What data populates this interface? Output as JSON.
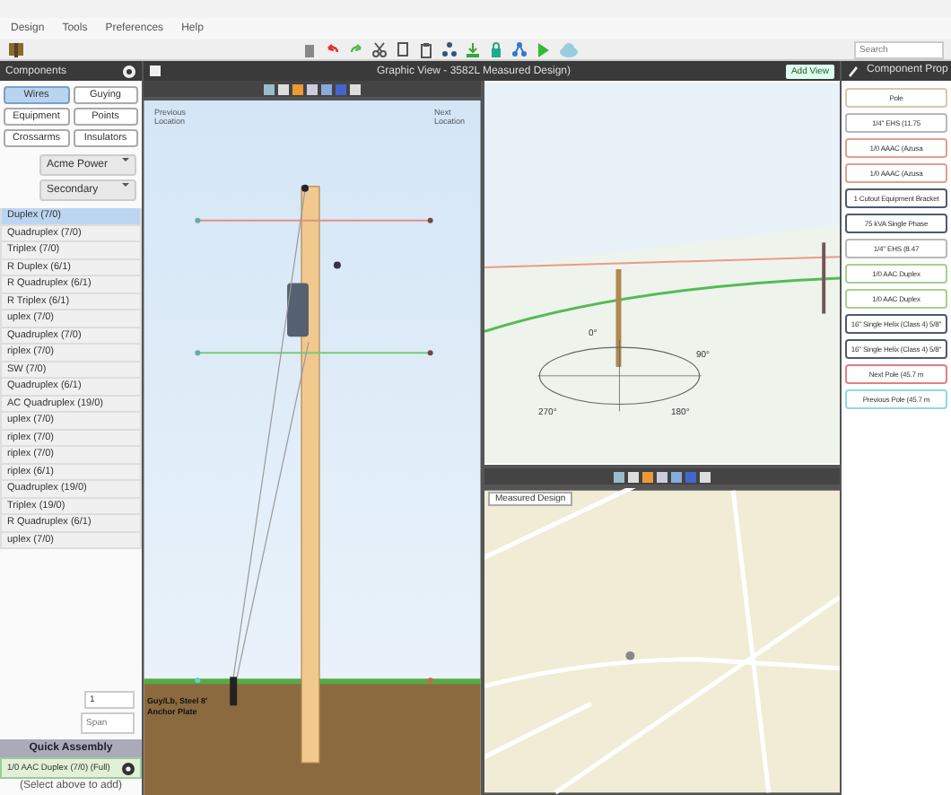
{
  "menu": [
    {
      "label": "Design"
    },
    {
      "label": "Tools"
    },
    {
      "label": "Preferences"
    },
    {
      "label": "Help"
    }
  ],
  "toolbar": {
    "search_placeholder": "Search"
  },
  "components_panel": {
    "title": "Components",
    "categories": [
      {
        "label": "Wires",
        "selected": true
      },
      {
        "label": "Guying",
        "selected": false
      },
      {
        "label": "Equipment",
        "selected": false
      },
      {
        "label": "Points",
        "selected": false
      },
      {
        "label": "Crossarms",
        "selected": false
      },
      {
        "label": "Insulators",
        "selected": false
      }
    ],
    "dropdowns": [
      "Acme Power",
      "Secondary"
    ],
    "items": [
      {
        "label": "Duplex (7/0)",
        "selected": true
      },
      {
        "label": "Quadruplex (7/0)",
        "selected": false
      },
      {
        "label": "Triplex (7/0)",
        "selected": false
      },
      {
        "label": "R Duplex (6/1)",
        "selected": false
      },
      {
        "label": "R Quadruplex (6/1)",
        "selected": false
      },
      {
        "label": "R Triplex (6/1)",
        "selected": false
      },
      {
        "label": "uplex (7/0)",
        "selected": false
      },
      {
        "label": "Quadruplex (7/0)",
        "selected": false
      },
      {
        "label": "riplex (7/0)",
        "selected": false
      },
      {
        "label": "SW (7/0)",
        "selected": false
      },
      {
        "label": "Quadruplex (6/1)",
        "selected": false
      },
      {
        "label": "AC Quadruplex (19/0)",
        "selected": false
      },
      {
        "label": "uplex (7/0)",
        "selected": false
      },
      {
        "label": "riplex (7/0)",
        "selected": false
      },
      {
        "label": "riplex (7/0)",
        "selected": false
      },
      {
        "label": "riplex (6/1)",
        "selected": false
      },
      {
        "label": "Quadruplex (19/0)",
        "selected": false
      },
      {
        "label": "Triplex (19/0)",
        "selected": false
      },
      {
        "label": "R Quadruplex (6/1)",
        "selected": false
      },
      {
        "label": "uplex (7/0)",
        "selected": false
      }
    ],
    "quantity": "1",
    "span_placeholder": "Span",
    "quick_assembly": {
      "title": "Quick Assembly",
      "item": "1/0 AAC Duplex (7/0) (Full)",
      "hint": "(Select above to add)"
    }
  },
  "graphic_view": {
    "title": "Graphic View - 3582L Measured Design)",
    "add_view": "Add View",
    "pole_view": {
      "previous": "Previous Location",
      "next": "Next Location",
      "annotation": "Guy/Lb, Steel 8' Anchor Plate"
    },
    "perspective_view": {
      "compass": [
        "0°",
        "90°",
        "180°",
        "270°"
      ]
    },
    "map_view": {
      "title": "Measured Design"
    }
  },
  "properties_panel": {
    "title": "Component Prop",
    "items": [
      {
        "label": "Pole",
        "color": "#d9c8a8"
      },
      {
        "label": "1/4\" EHS (11.75",
        "color": "#b8b8b8"
      },
      {
        "label": "1/0 AAAC (Azusa",
        "color": "#e0a090"
      },
      {
        "label": "1/0 AAAC (Azusa",
        "color": "#e0a090"
      },
      {
        "label": "1 Cutout Equipment Bracket",
        "color": "#505a70"
      },
      {
        "label": "75 kVA Single Phase",
        "color": "#505a70"
      },
      {
        "label": "1/4\" EHS (8.47",
        "color": "#b8b8b8"
      },
      {
        "label": "1/0 AAC Duplex",
        "color": "#a8d090"
      },
      {
        "label": "1/0 AAC Duplex",
        "color": "#a8d090"
      },
      {
        "label": "16\" Single Helix (Class 4) 5/8\"",
        "color": "#505a70"
      },
      {
        "label": "16\" Single Helix (Class 4) 5/8\"",
        "color": "#505a70"
      },
      {
        "label": "Next Pole (45.7 m",
        "color": "#e08080"
      },
      {
        "label": "Previous Pole (45.7 m",
        "color": "#90d8e0"
      }
    ]
  }
}
